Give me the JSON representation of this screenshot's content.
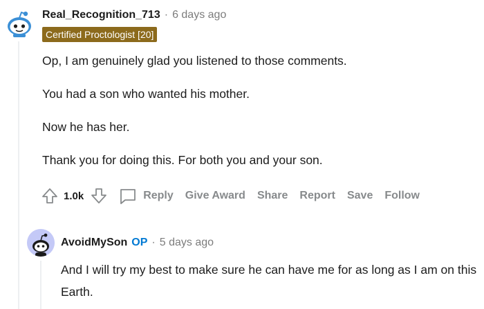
{
  "comment": {
    "username": "Real_Recognition_713",
    "separator": "·",
    "time": "6 days ago",
    "flair": "Certified Proctologist [20]",
    "paragraphs": [
      "Op, I am genuinely glad you listened to those comments.",
      "You had a son who wanted his mother.",
      "Now he has her.",
      "Thank you for doing this. For both you and your son."
    ],
    "votes": "1.0k",
    "actions": {
      "reply": "Reply",
      "give_award": "Give Award",
      "share": "Share",
      "report": "Report",
      "save": "Save",
      "follow": "Follow"
    }
  },
  "reply": {
    "username": "AvoidMySon",
    "op_badge": "OP",
    "separator": "·",
    "time": "5 days ago",
    "text": "And I will try my best to make sure he can have me for as long as I am on this Earth."
  },
  "colors": {
    "flair_bg": "#8c6a1c",
    "op_blue": "#0079d3",
    "meta_gray": "#7c7c7c",
    "avatar1_blue": "#3b8fd6",
    "avatar2_bg": "#c4c9f7"
  },
  "icons": [
    "snoo-avatar-icon",
    "upvote-icon",
    "downvote-icon",
    "comment-reply-icon",
    "snoo-avatar-icon"
  ]
}
